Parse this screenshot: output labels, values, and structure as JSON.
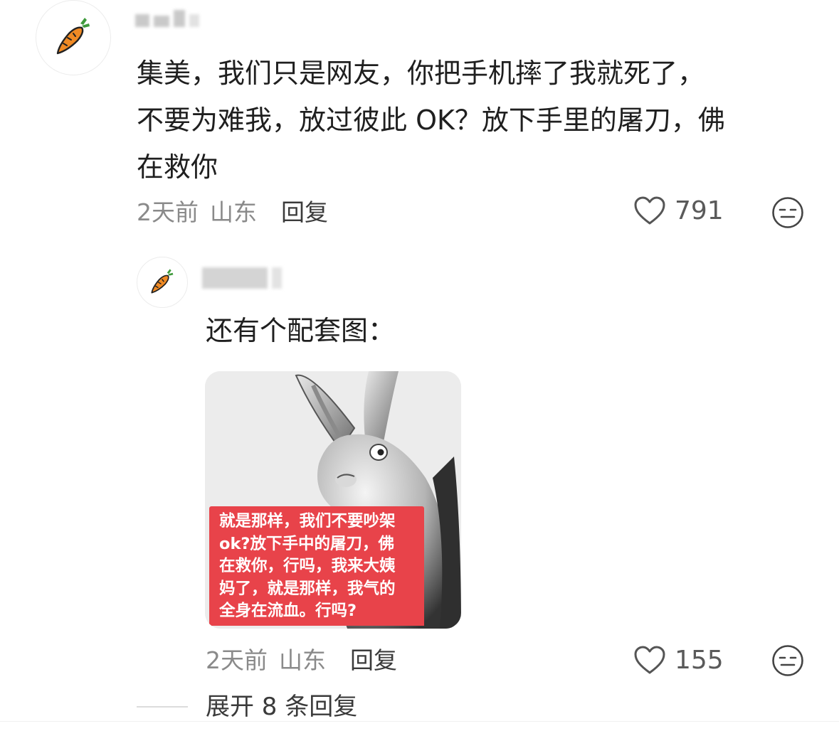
{
  "comment": {
    "text_lines": [
      "集美，我们只是网友，你把手机摔了我就死了，",
      "不要为难我，放过彼此 OK？放下手里的屠刀，佛",
      "在救你"
    ],
    "time": "2天前",
    "location": "山东",
    "reply_label": "回复",
    "likes": "791",
    "avatar_icon": "carrot-icon",
    "reaction_icon": "neutral-face-icon"
  },
  "reply": {
    "text": "还有个配套图：",
    "image_caption_lines": [
      "就是那样，我们不要吵架",
      "ok?放下手中的屠刀，佛",
      "在救你，行吗，我来大姨",
      "妈了，就是那样，我气的",
      "全身在流血。行吗?"
    ],
    "time": "2天前",
    "location": "山东",
    "reply_label": "回复",
    "likes": "155",
    "avatar_icon": "carrot-icon",
    "reaction_icon": "neutral-face-icon"
  },
  "expand_replies_label": "展开 8 条回复",
  "colors": {
    "meme_caption_bg": "#e8434a",
    "carrot": "#f08a24",
    "carrot_leaf": "#3f9a3c"
  }
}
